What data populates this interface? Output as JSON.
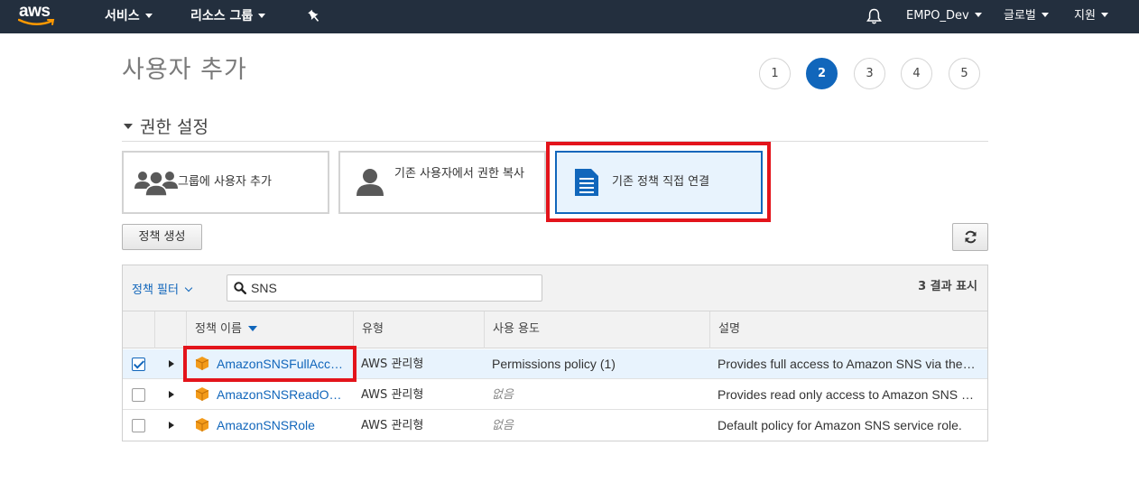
{
  "nav": {
    "logo": "aws",
    "services": "서비스",
    "resource_groups": "리소스 그룹",
    "account": "EMPO_Dev",
    "region": "글로벌",
    "support": "지원",
    "icons": [
      "pin-icon",
      "bell-icon"
    ]
  },
  "page": {
    "title": "사용자 추가",
    "steps": [
      "1",
      "2",
      "3",
      "4",
      "5"
    ],
    "current_step": 2
  },
  "permissions": {
    "heading": "권한 설정",
    "options": [
      {
        "label": "그룹에 사용자 추가",
        "icon": "group-icon"
      },
      {
        "label": "기존 사용자에서 권한 복사",
        "icon": "user-icon"
      },
      {
        "label": "기존 정책 직접 연결",
        "icon": "document-icon",
        "selected": true
      }
    ],
    "create_policy": "정책 생성"
  },
  "filter": {
    "label": "정책 필터",
    "search_value": "SNS",
    "result_count": "3 결과 표시"
  },
  "table": {
    "columns": [
      "정책 이름",
      "유형",
      "사용 용도",
      "설명"
    ],
    "rows": [
      {
        "checked": true,
        "name": "AmazonSNSFullAcc…",
        "type": "AWS 관리형",
        "usage": "Permissions policy (1)",
        "description": "Provides full access to Amazon SNS via the…"
      },
      {
        "checked": false,
        "name": "AmazonSNSReadO…",
        "type": "AWS 관리형",
        "usage": "없음",
        "description": "Provides read only access to Amazon SNS …"
      },
      {
        "checked": false,
        "name": "AmazonSNSRole",
        "type": "AWS 관리형",
        "usage": "없음",
        "description": "Default policy for Amazon SNS service role."
      }
    ]
  },
  "colors": {
    "nav_bg": "#232f3e",
    "accent": "#1166bb",
    "highlight": "#e3141b",
    "selected_bg": "#e8f3fd",
    "policy_icon": "#f39b1a"
  }
}
